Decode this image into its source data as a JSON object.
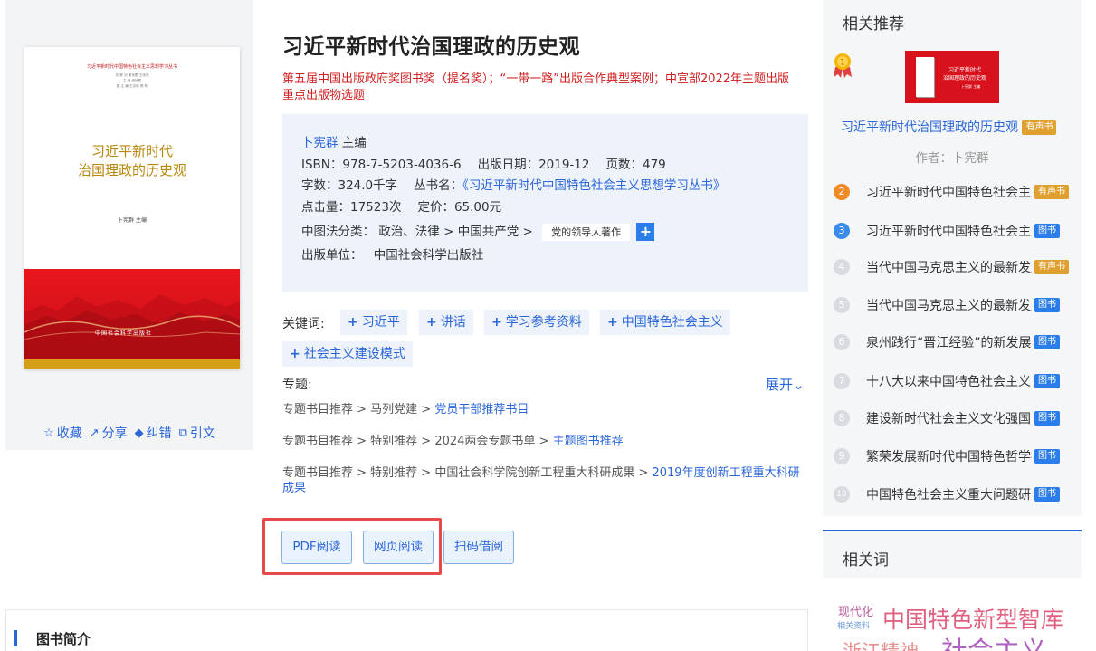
{
  "book": {
    "title": "习近平新时代治国理政的历史观",
    "awards": "第五届中国出版政府奖图书奖（提名奖）；“一带一路”出版合作典型案例；中宣部2022年主题出版重点出版物选题",
    "editor": "卜宪群",
    "editor_role": "主编",
    "isbn_label": "ISBN：",
    "isbn": "978-7-5203-4036-6",
    "date_label": "出版日期：",
    "date": "2019-12",
    "pages_label": "页数：",
    "pages": "479",
    "words_label": "字数：",
    "words": "324.0千字",
    "series_label": "丛书名：",
    "series": "《习近平新时代中国特色社会主义思想学习丛书》",
    "clicks_label": "点击量：",
    "clicks": "17523次",
    "price_label": "定价：",
    "price": "65.00元",
    "cls_label": "中图法分类：",
    "cls_path": "政治、法律 > 中国共产党 >",
    "cls_tag": "党的领导人著作",
    "cls_plus": "+",
    "publisher_label": "出版单位：",
    "publisher": "中国社会科学出版社"
  },
  "cover": {
    "series_line": "习近平新时代中国特色社会主义思想学习丛书",
    "editors": [
      "总 顾 问 谢伏瞻  王伟光",
      "主    编  谢伏瞻",
      "副 主 编  王京清  蔡 昉"
    ],
    "title_line1": "习近平新时代",
    "title_line2": "治国理政的历史观",
    "author": "卜宪群  主编",
    "publisher": "中国社会科学出版社"
  },
  "left_actions": [
    {
      "icon": "☆",
      "label": "收藏"
    },
    {
      "icon": "↗",
      "label": "分享"
    },
    {
      "icon": "◆",
      "label": "纠错"
    },
    {
      "icon": "⧉",
      "label": "引文"
    }
  ],
  "keywords": {
    "label": "关键词:",
    "items": [
      "习近平",
      "讲话",
      "学习参考资料",
      "中国特色社会主义",
      "社会主义建设模式"
    ]
  },
  "topics": {
    "label": "专题:",
    "expand": "展开",
    "paths": [
      {
        "prefix": "专题书目推荐 > 马列党建 > ",
        "link": "党员干部推荐书目"
      },
      {
        "prefix": "专题书目推荐 > 特别推荐 > 2024两会专题书单 > ",
        "link": "主题图书推荐"
      },
      {
        "prefix": "专题书目推荐 > 特别推荐 > 中国社会科学院创新工程重大科研成果 > ",
        "link": "2019年度创新工程重大科研成果"
      }
    ]
  },
  "read_buttons": [
    "PDF阅读",
    "网页阅读",
    "扫码借阅"
  ],
  "intro": {
    "title": "图书简介"
  },
  "recommend": {
    "title": "相关推荐",
    "thumb": {
      "line1": "习近平新时代",
      "line2": "治国理政的历史观",
      "line3": "卜宪群 主编"
    },
    "top_title": "习近平新时代治国理政的历史观",
    "top_badge": "有声书",
    "top_author": "作者：卜宪群",
    "items": [
      {
        "rank": "2",
        "title": "习近平新时代中国特色社会主义思想学习丛书",
        "badge": "有声书"
      },
      {
        "rank": "3",
        "title": "习近平新时代中国特色社会主义思想研究",
        "badge": "图书"
      },
      {
        "rank": "4",
        "title": "当代中国马克思主义的最新发展",
        "badge": "有声书"
      },
      {
        "rank": "5",
        "title": "当代中国马克思主义的最新发展研究",
        "badge": "图书"
      },
      {
        "rank": "6",
        "title": "泉州践行“晋江经验”的新发展",
        "badge": "图书"
      },
      {
        "rank": "7",
        "title": "十八大以来中国特色社会主义",
        "badge": "图书"
      },
      {
        "rank": "8",
        "title": "建设新时代社会主义文化强国",
        "badge": "图书"
      },
      {
        "rank": "9",
        "title": "繁荣发展新时代中国特色哲学社会科学",
        "badge": "图书"
      },
      {
        "rank": "10",
        "title": "中国特色社会主义重大问题研究",
        "badge": "图书"
      }
    ]
  },
  "related_words": {
    "title": "相关词",
    "items": [
      {
        "text": "现代化",
        "color": "#c060a0"
      },
      {
        "text": "相关资料",
        "color": "#6a9ad8"
      },
      {
        "text": "中国特色新型智库",
        "color": "#e06080"
      },
      {
        "text": "浙江精神",
        "color": "#e89090"
      },
      {
        "text": "社会主义",
        "color": "#b060c0"
      }
    ]
  },
  "colors": {
    "link": "#2b66d9",
    "award": "#d01f1f",
    "badge_gold": "#e0a030",
    "badge_blue": "#2b7de9",
    "highlight": "#e84a4a"
  }
}
